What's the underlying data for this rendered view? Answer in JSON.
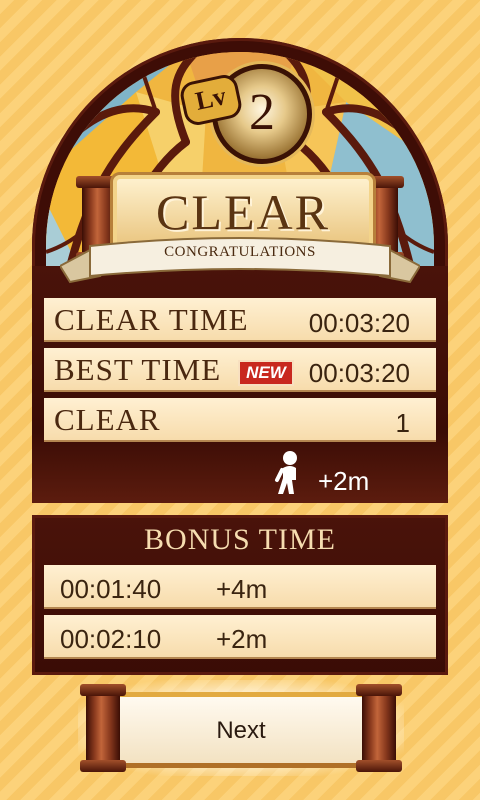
{
  "level": {
    "prefix": "Lv",
    "number": "2"
  },
  "header": {
    "title": "CLEAR",
    "subtitle": "CONGRATULATIONS"
  },
  "stats": [
    {
      "label": "CLEAR TIME",
      "value": "00:03:20"
    },
    {
      "label": "BEST TIME",
      "value": "00:03:20",
      "badge": "NEW"
    },
    {
      "label": "CLEAR",
      "value": "1"
    }
  ],
  "walk_bonus": {
    "icon": "walking-person-icon",
    "value": "+2m"
  },
  "bonus": {
    "title": "BONUS TIME",
    "rows": [
      {
        "time": "00:01:40",
        "gain": "+4m"
      },
      {
        "time": "00:02:10",
        "gain": "+2m"
      }
    ]
  },
  "next_button": {
    "label": "Next"
  },
  "colors": {
    "background": "#fcd27a",
    "panel": "#3e0d06",
    "row": "#fff0d2",
    "badge_red": "#c8281e"
  }
}
